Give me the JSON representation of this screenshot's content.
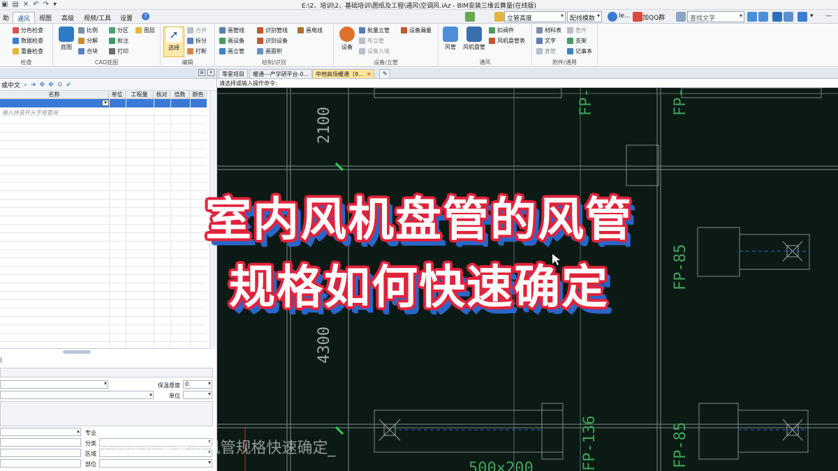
{
  "titlebar": {
    "title": "E:\\2、培训\\2、基础培训\\图纸及工程\\通风\\空调风.iAz - BIM安装三维云算量(在线版)"
  },
  "tabs": [
    "助",
    "通风",
    "视图",
    "高级",
    "视频/工具",
    "设置"
  ],
  "tabbar_right": {
    "combo_floor": "立管高度",
    "combo_mode": "配线模数",
    "user": "le...",
    "qq": "加QQ群",
    "search_placeholder": "查找文字"
  },
  "ribbon": {
    "groups": [
      {
        "name": "检查",
        "items": [
          "分色检查",
          "数据检查",
          "重叠检查"
        ]
      },
      {
        "name": "CAD底图",
        "items": [
          "底图",
          "比例",
          "分解",
          "合块",
          "分区",
          "批注",
          "打印",
          "图层"
        ]
      },
      {
        "name": "编辑",
        "items": [
          "选择",
          "合并",
          "拆分",
          "打断"
        ]
      },
      {
        "name": "绘制/识别",
        "items": [
          "画管线",
          "画设备",
          "画立管",
          "识别管线",
          "识别设备",
          "画面积",
          "画电线"
        ]
      },
      {
        "name": "设备/立管",
        "items": [
          "设备",
          "批量立管",
          "布立管",
          "设备入墙",
          "设备漏量"
        ]
      },
      {
        "name": "通风",
        "items": [
          "风管",
          "风机盘管",
          "扣阀件",
          "风机盘管表"
        ]
      },
      {
        "name": "附件/通用",
        "items": [
          "材料表",
          "文字",
          "套管",
          "管件",
          "支架",
          "记事本"
        ]
      }
    ]
  },
  "left_pane": {
    "search_label": "或中文",
    "columns": [
      "名称",
      "单位",
      "工程量",
      "核对",
      "倍数",
      "颜色"
    ],
    "hint": "输入拼音开头字母查询",
    "props": {
      "insulation_label": "保温厚度",
      "insulation_value": "0",
      "unit_label": "单位",
      "specialty_label": "专业",
      "category_label": "分类",
      "region_label": "区域",
      "part_label": "部位"
    }
  },
  "doc_tabs": [
    "零星项目",
    "暖通---产学研平台-0...",
    "中地商场暖通（9..."
  ],
  "command_prompt": "请选择或输入操作命令:",
  "cad": {
    "labels": [
      "2100",
      "FP-",
      "FP-",
      "FP-85",
      "4300",
      "FP-136",
      "FP-85",
      "500×200"
    ]
  },
  "overlay": {
    "line1": "室内风机盘管的风管",
    "line2": "规格如何快速确定",
    "subtitle": "室内风机盘管的风管规格快速确定_"
  }
}
